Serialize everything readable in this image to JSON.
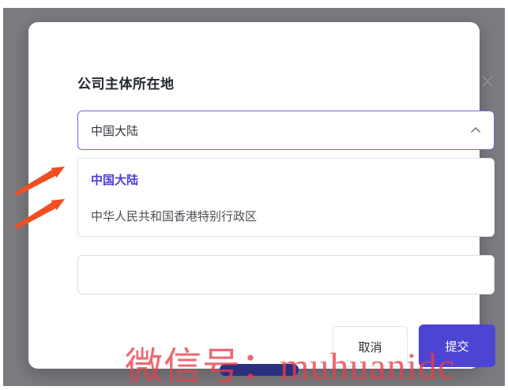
{
  "dialog": {
    "title": "公司主体所在地",
    "select": {
      "value": "中国大陆"
    },
    "dropdown": {
      "options": [
        {
          "label": "中国大陆",
          "selected": true
        },
        {
          "label": "中华人民共和国香港特别行政区",
          "selected": false
        }
      ]
    },
    "input": {
      "value": "",
      "placeholder": ""
    },
    "buttons": {
      "cancel": "取消",
      "submit": "提交"
    }
  },
  "watermark": "微信号：muhuanidc",
  "icons": {
    "close": "close-icon",
    "chevron_up": "chevron-up-icon",
    "annotation_arrows": "orange-arrow-icon"
  },
  "colors": {
    "accent": "#4e44d3",
    "select_border": "#6f66dd",
    "overlay": "#7c7c80",
    "arrow_orange": "#f04e23",
    "watermark_red": "#e83e4b",
    "navy_bar": "#2b2f7f",
    "selected_option_text": "#4a3fd4"
  }
}
